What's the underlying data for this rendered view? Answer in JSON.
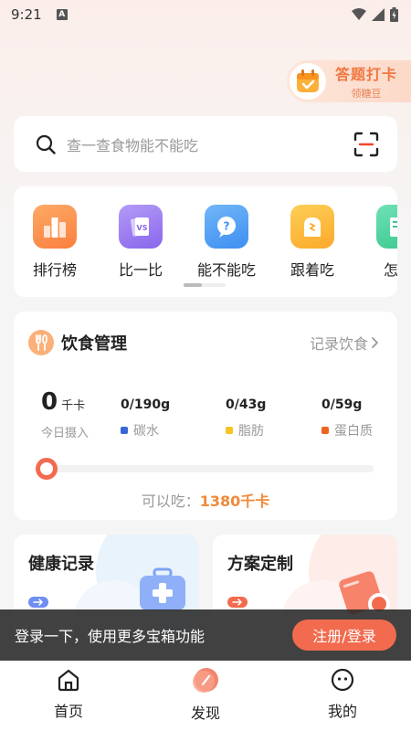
{
  "status_bar": {
    "time": "9:21",
    "notification": "A"
  },
  "checkin": {
    "title": "答题打卡",
    "subtitle": "领糖豆"
  },
  "search": {
    "placeholder": "查一查食物能不能吃"
  },
  "shortcuts": [
    {
      "label": "排行榜",
      "icon": "ranking-icon",
      "color": "#fb8d4e"
    },
    {
      "label": "比一比",
      "icon": "versus-icon",
      "color": "#9b7cf0"
    },
    {
      "label": "能不能吃",
      "icon": "question-bubble-icon",
      "color": "#4d9ff5"
    },
    {
      "label": "跟着吃",
      "icon": "bread-icon",
      "color": "#fbb83a"
    },
    {
      "label": "怎么",
      "icon": "book-icon",
      "color": "#4fd1a2"
    }
  ],
  "diet": {
    "title": "饮食管理",
    "record_link": "记录饮食",
    "intake_value": "0",
    "intake_unit": "千卡",
    "intake_label": "今日摄入",
    "carbs_value": "0/190g",
    "carbs_label": "碳水",
    "fat_value": "0/43g",
    "fat_label": "脂肪",
    "protein_value": "0/59g",
    "protein_label": "蛋白质",
    "progress_fraction": 0,
    "can_eat_label": "可以吃：",
    "can_eat_value": "1380千卡"
  },
  "colors": {
    "accent": "#f26b4f",
    "carbs": "#3866d6",
    "fat": "#f6c325",
    "protein": "#f0621d"
  },
  "features": [
    {
      "title": "健康记录",
      "icon": "medical-kit-icon"
    },
    {
      "title": "方案定制",
      "icon": "plan-search-icon"
    }
  ],
  "login_banner": {
    "text": "登录一下，使用更多宝箱功能",
    "button": "注册/登录"
  },
  "nav": [
    {
      "label": "首页",
      "icon": "home-icon"
    },
    {
      "label": "发现",
      "icon": "discover-icon"
    },
    {
      "label": "我的",
      "icon": "profile-icon"
    }
  ]
}
